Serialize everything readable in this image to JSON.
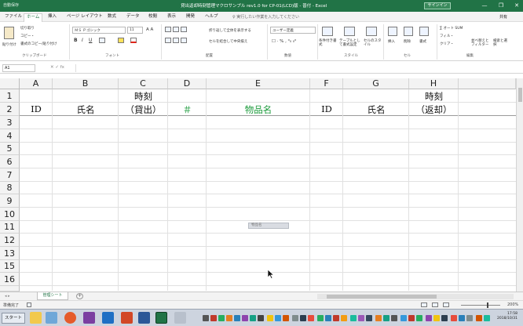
{
  "titlebar": {
    "autosave": "自動保存",
    "title": "貸出返却時刻管理マクロサンプル rev1.0 for CP-01(LCD)版 - 普付 - Excel",
    "signin": "サインイン",
    "minimize": "—",
    "restore": "❐",
    "close": "✕"
  },
  "tabs": [
    "ファイル",
    "ホーム",
    "挿入",
    "ページ レイアウト",
    "数式",
    "データ",
    "校閲",
    "表示",
    "開発",
    "ヘルプ"
  ],
  "tellme": "♀ 実行したい作業を入力してください",
  "share": "共有",
  "ribbon": {
    "paste": "貼り付け",
    "cut": "切り取り",
    "copy": "コピー・",
    "format_painter": "書式のコピー/貼り付け",
    "clipboard": "クリップボード",
    "font_name": "ＭＳ Ｐゴシック",
    "font_size": "11",
    "font_group": "フォント",
    "wrap_text": "折り返して全体を表示する",
    "merge_center": "セルを結合して中央揃え",
    "alignment_group": "配置",
    "number_format": "ユーザー定義",
    "number_group": "数値",
    "cond_format": "条件付き書式",
    "as_table": "テーブルとして書式設定",
    "cell_styles": "セルのスタイル",
    "styles_group": "スタイル",
    "insert": "挿入",
    "delete": "削除",
    "format": "書式",
    "cells_group": "セル",
    "autosum": "∑ オート SUM",
    "fill": "フィル・",
    "clear": "クリア・",
    "sort_filter": "並べ替えとフィルター",
    "find_select": "検索と選択",
    "editing_group": "編集"
  },
  "formula_bar": {
    "name_box": "A1",
    "buttons": "✕  ✓  fx",
    "value": ""
  },
  "columns": [
    "A",
    "B",
    "C",
    "D",
    "E",
    "F",
    "G",
    "H"
  ],
  "rows": [
    "1",
    "2",
    "3",
    "4",
    "5",
    "6",
    "7",
    "8",
    "9",
    "10",
    "11",
    "12",
    "13",
    "15",
    "16"
  ],
  "cells": {
    "c1": "時刻",
    "h1": "時刻",
    "a2": "ID",
    "b2": "氏名",
    "c2": "（貸出）",
    "d2": "＃",
    "e2": "物品名",
    "f2": "ID",
    "g2": "氏名",
    "h2": "（返却）"
  },
  "accent_green": "#1a9a3a",
  "tooltip": "物品名",
  "sheet_tab": "管理シート",
  "add_sheet": "+",
  "status": {
    "ready": "準備完了",
    "zoom": "200%"
  },
  "taskbar": {
    "start": "スタート",
    "clock_time": "17:58",
    "clock_date": "2018/10/31"
  }
}
